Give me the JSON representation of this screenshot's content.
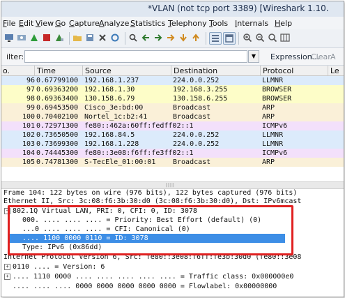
{
  "window": {
    "title": "*VLAN (not tcp port 3389)   [Wireshark 1.10."
  },
  "menu": [
    {
      "label": "File"
    },
    {
      "label": "Edit"
    },
    {
      "label": "View"
    },
    {
      "label": "Go"
    },
    {
      "label": "Capture"
    },
    {
      "label": "Analyze"
    },
    {
      "label": "Statistics"
    },
    {
      "label": "Telephony"
    },
    {
      "label": "Tools"
    },
    {
      "label": "Internals"
    },
    {
      "label": "Help"
    }
  ],
  "toolbar": {
    "icons": [
      "interface-list-icon",
      "options-icon",
      "start-capture-icon",
      "stop-capture-icon",
      "restart-icon",
      "open-file-icon",
      "save-icon",
      "close-file-icon",
      "reload-icon",
      "find-icon",
      "go-back-icon",
      "go-forward-icon",
      "go-to-packet-icon",
      "go-first-icon",
      "go-last-icon",
      "colorize-icon",
      "autoscroll-icon",
      "zoom-in-icon",
      "zoom-out-icon",
      "normal-size-icon",
      "resize-columns-icon"
    ]
  },
  "filter": {
    "label": "ilter:",
    "value": "",
    "expression_label": "Expression...",
    "clear_label": "Clear",
    "apply_label": "A"
  },
  "packet_list": {
    "columns": [
      "o.",
      "Time",
      "Source",
      "Destination",
      "Protocol",
      "Le"
    ],
    "rows": [
      {
        "no": "96",
        "time": "0.67799100",
        "source": "192.168.1.237",
        "destination": "224.0.0.252",
        "protocol": "LLMNR",
        "bg": "#dcebfb"
      },
      {
        "no": "97",
        "time": "0.69363200",
        "source": "192.168.1.30",
        "destination": "192.168.3.255",
        "protocol": "BROWSER",
        "bg": "#fdfdc8"
      },
      {
        "no": "98",
        "time": "0.69363400",
        "source": "130.158.6.79",
        "destination": "130.158.6.255",
        "protocol": "BROWSER",
        "bg": "#fdfdc8"
      },
      {
        "no": "99",
        "time": "0.69453500",
        "source": "Cisco_3e:bd:00",
        "destination": "Broadcast",
        "protocol": "ARP",
        "bg": "#faf0d8"
      },
      {
        "no": "100",
        "time": "0.70402100",
        "source": "Nortel_1c:b2:41",
        "destination": "Broadcast",
        "protocol": "ARP",
        "bg": "#faf0d8"
      },
      {
        "no": "101",
        "time": "0.72971300",
        "source": "fe80::462a:60ff:fedff02::1",
        "destination": "",
        "protocol": "ICMPv6",
        "bg": "#f3e0fb"
      },
      {
        "no": "102",
        "time": "0.73650500",
        "source": "192.168.84.5",
        "destination": "224.0.0.252",
        "protocol": "LLMNR",
        "bg": "#dcebfb"
      },
      {
        "no": "103",
        "time": "0.73699300",
        "source": "192.168.1.228",
        "destination": "224.0.0.252",
        "protocol": "LLMNR",
        "bg": "#dcebfb"
      },
      {
        "no": "104",
        "time": "0.74445300",
        "source": "fe80::3e08:f6ff:fe3ff02::1",
        "destination": "",
        "protocol": "ICMPv6",
        "bg": "#f3e0fb"
      },
      {
        "no": "105",
        "time": "0.74781300",
        "source": "S-TecEle_01:00:01",
        "destination": "Broadcast",
        "protocol": "ARP",
        "bg": "#faf0d8"
      }
    ]
  },
  "details": {
    "rows": [
      {
        "text": "Frame 104: 122 bytes on wire (976 bits), 122 bytes captured (976 bits)",
        "toggle": "",
        "indent": 0
      },
      {
        "text": "Ethernet II, Src: 3c:08:f6:3b:30:d0 (3c:08:f6:3b:30:d0), Dst: IPv6mcast",
        "toggle": "",
        "indent": 0
      },
      {
        "text": "802.1Q Virtual LAN, PRI: 0, CFI: 0, ID: 3078",
        "toggle": "−",
        "indent": 0
      },
      {
        "text": "000. .... .... .... = Priority: Best Effort (default) (0)",
        "toggle": "",
        "indent": 1
      },
      {
        "text": "...0 .... .... .... = CFI: Canonical (0)",
        "toggle": "",
        "indent": 1
      },
      {
        "text": ".... 1100 0000 0110 = ID: 3078",
        "toggle": "",
        "indent": 1,
        "selected": true
      },
      {
        "text": "Type: IPv6 (0x86dd)",
        "toggle": "",
        "indent": 1
      },
      {
        "text": "Internet Protocol Version 6, Src: fe80::3e08:f6ff:fe3b:30d0 (fe80::3e08",
        "toggle": "",
        "indent": 0
      },
      {
        "text": "0110 .... = Version: 6",
        "toggle": "+",
        "indent": 0
      },
      {
        "text": ".... 1110 0000 .... .... .... .... .... = Traffic class: 0x000000e0",
        "toggle": "+",
        "indent": 0
      },
      {
        "text": ".... .... .... 0000 0000 0000 0000 0000 = Flowlabel: 0x00000000",
        "toggle": "",
        "indent": 1
      }
    ]
  },
  "colors": {
    "selected_row": "#3d8ee6",
    "highlight_box": "#e02020"
  }
}
